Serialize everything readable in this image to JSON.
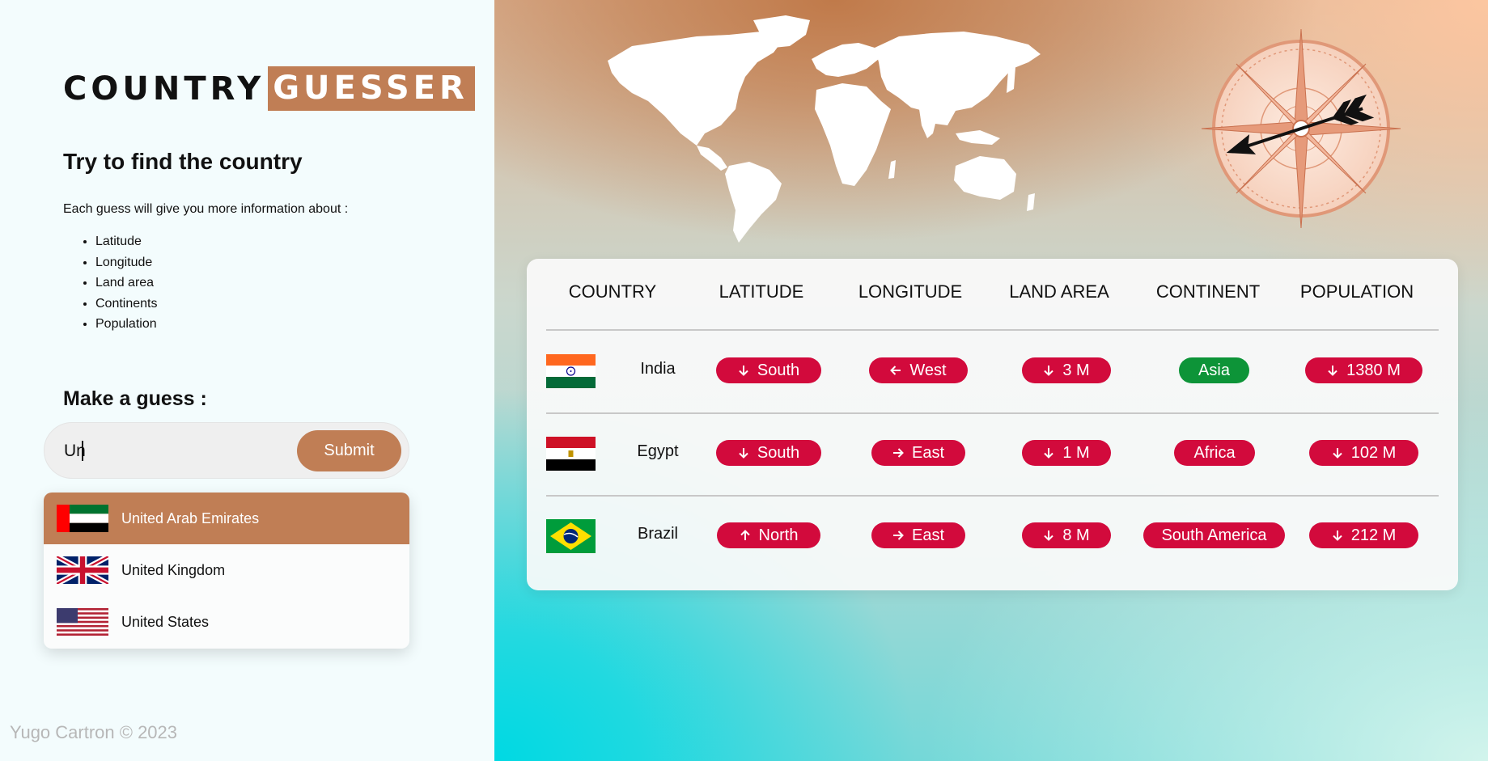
{
  "logo": {
    "part1": "COUNTRY",
    "part2": "GUESSER"
  },
  "intro": {
    "title": "Try to find the country",
    "description": "Each guess will give you more information about :",
    "features": [
      "Latitude",
      "Longitude",
      "Land area",
      "Continents",
      "Population"
    ]
  },
  "guess": {
    "title": "Make a guess :",
    "input_value": "Un",
    "submit_label": "Submit"
  },
  "suggestions": [
    {
      "name": "United Arab Emirates",
      "flag": "uae-flag",
      "highlighted": true
    },
    {
      "name": "United Kingdom",
      "flag": "uk-flag",
      "highlighted": false
    },
    {
      "name": "United States",
      "flag": "us-flag",
      "highlighted": false
    }
  ],
  "footer": "Yugo Cartron © 2023",
  "table": {
    "headers": [
      "COUNTRY",
      "LATITUDE",
      "LONGITUDE",
      "LAND AREA",
      "CONTINENT",
      "POPULATION"
    ],
    "rows": [
      {
        "country": "India",
        "flag": "india-flag",
        "latitude": {
          "text": "South",
          "arrow": "down",
          "status": "wrong"
        },
        "longitude": {
          "text": "West",
          "arrow": "left",
          "status": "wrong"
        },
        "land_area": {
          "text": "3 M",
          "arrow": "down",
          "status": "wrong"
        },
        "continent": {
          "text": "Asia",
          "arrow": "",
          "status": "correct"
        },
        "population": {
          "text": "1380 M",
          "arrow": "down",
          "status": "wrong"
        }
      },
      {
        "country": "Egypt",
        "flag": "egypt-flag",
        "latitude": {
          "text": "South",
          "arrow": "down",
          "status": "wrong"
        },
        "longitude": {
          "text": "East",
          "arrow": "right",
          "status": "wrong"
        },
        "land_area": {
          "text": "1 M",
          "arrow": "down",
          "status": "wrong"
        },
        "continent": {
          "text": "Africa",
          "arrow": "",
          "status": "wrong"
        },
        "population": {
          "text": "102 M",
          "arrow": "down",
          "status": "wrong"
        }
      },
      {
        "country": "Brazil",
        "flag": "brazil-flag",
        "latitude": {
          "text": "North",
          "arrow": "up",
          "status": "wrong"
        },
        "longitude": {
          "text": "East",
          "arrow": "right",
          "status": "wrong"
        },
        "land_area": {
          "text": "8 M",
          "arrow": "down",
          "status": "wrong"
        },
        "continent": {
          "text": "South America",
          "arrow": "",
          "status": "wrong"
        },
        "population": {
          "text": "212 M",
          "arrow": "down",
          "status": "wrong"
        }
      }
    ]
  },
  "colors": {
    "accent": "#c07e55",
    "wrong": "#d20a3c",
    "correct": "#0d9438"
  }
}
